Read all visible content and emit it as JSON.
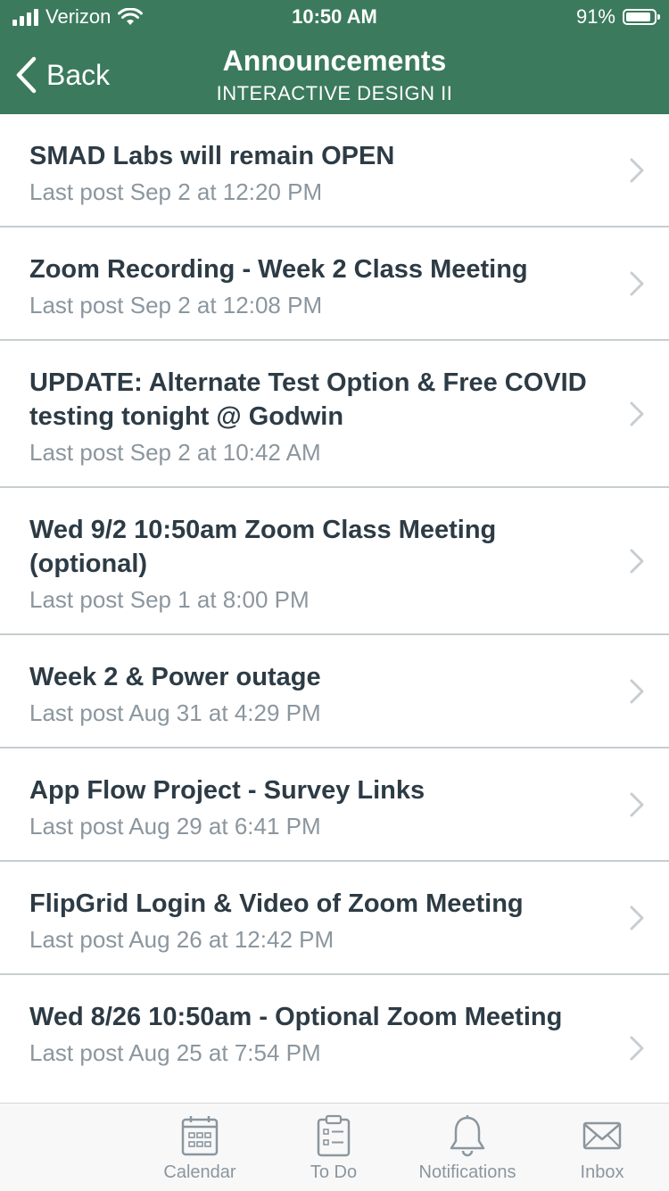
{
  "status_bar": {
    "carrier": "Verizon",
    "time": "10:50 AM",
    "battery": "91%",
    "signal_icon": "signal-bars-icon",
    "wifi_icon": "wifi-icon",
    "battery_icon": "battery-icon"
  },
  "nav": {
    "back_label": "Back",
    "title": "Announcements",
    "subtitle": "INTERACTIVE DESIGN II"
  },
  "announcements": [
    {
      "title": "SMAD Labs will remain OPEN",
      "meta": "Last post Sep 2 at 12:20 PM"
    },
    {
      "title": "Zoom Recording - Week 2 Class Meeting",
      "meta": "Last post Sep 2 at 12:08 PM"
    },
    {
      "title": "UPDATE: Alternate Test Option & Free COVID testing tonight @ Godwin",
      "meta": "Last post Sep 2 at 10:42 AM"
    },
    {
      "title": "Wed 9/2 10:50am Zoom Class Meeting (optional)",
      "meta": "Last post Sep 1 at 8:00 PM"
    },
    {
      "title": "Week 2 & Power outage",
      "meta": "Last post Aug 31 at 4:29 PM"
    },
    {
      "title": "App Flow Project - Survey Links",
      "meta": "Last post Aug 29 at 6:41 PM"
    },
    {
      "title": "FlipGrid Login & Video of Zoom Meeting",
      "meta": "Last post Aug 26 at 12:42 PM"
    },
    {
      "title": "Wed 8/26 10:50am - Optional Zoom Meeting",
      "meta": "Last post Aug 25 at 7:54 PM"
    }
  ],
  "tabs": [
    {
      "label": "Calendar",
      "icon": "calendar-icon"
    },
    {
      "label": "To Do",
      "icon": "clipboard-icon"
    },
    {
      "label": "Notifications",
      "icon": "bell-icon"
    },
    {
      "label": "Inbox",
      "icon": "envelope-icon"
    }
  ],
  "colors": {
    "header_bg": "#3b7a5d",
    "title_text": "#2d3b45",
    "meta_text": "#8b969e",
    "divider": "#c7cdd1",
    "tab_icon": "#8b969e"
  }
}
